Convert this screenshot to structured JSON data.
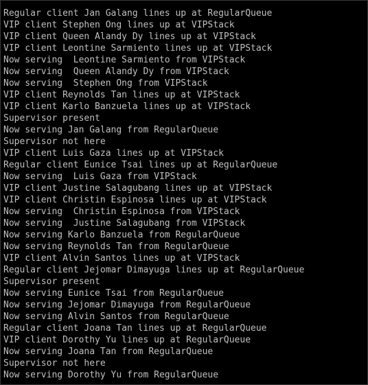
{
  "console": {
    "lines": [
      "Regular client Jan Galang lines up at RegularQueue",
      "VIP client Stephen Ong lines up at VIPStack",
      "VIP client Queen Alandy Dy lines up at VIPStack",
      "VIP client Leontine Sarmiento lines up at VIPStack",
      "Now serving  Leontine Sarmiento from VIPStack",
      "Now serving  Queen Alandy Dy from VIPStack",
      "Now serving  Stephen Ong from VIPStack",
      "VIP client Reynolds Tan lines up at VIPStack",
      "VIP client Karlo Banzuela lines up at VIPStack",
      "Supervisor present",
      "Now serving Jan Galang from RegularQueue",
      "Supervisor not here",
      "VIP client Luis Gaza lines up at VIPStack",
      "Regular client Eunice Tsai lines up at RegularQueue",
      "Now serving  Luis Gaza from VIPStack",
      "VIP client Justine Salagubang lines up at VIPStack",
      "VIP client Christin Espinosa lines up at VIPStack",
      "Now serving  Christin Espinosa from VIPStack",
      "Now serving  Justine Salagubang from VIPStack",
      "Now serving Karlo Banzuela from RegularQueue",
      "Now serving Reynolds Tan from RegularQueue",
      "VIP client Alvin Santos lines up at VIPStack",
      "Regular client Jejomar Dimayuga lines up at RegularQueue",
      "Supervisor present",
      "Now serving Eunice Tsai from RegularQueue",
      "Now serving Jejomar Dimayuga from RegularQueue",
      "Now serving Alvin Santos from RegularQueue",
      "Regular client Joana Tan lines up at RegularQueue",
      "VIP client Dorothy Yu lines up at RegularQueue",
      "Now serving Joana Tan from RegularQueue",
      "Supervisor not here",
      "Now serving Dorothy Yu from RegularQueue"
    ]
  },
  "colors": {
    "background": "#000000",
    "text": "#c0c0c0"
  }
}
